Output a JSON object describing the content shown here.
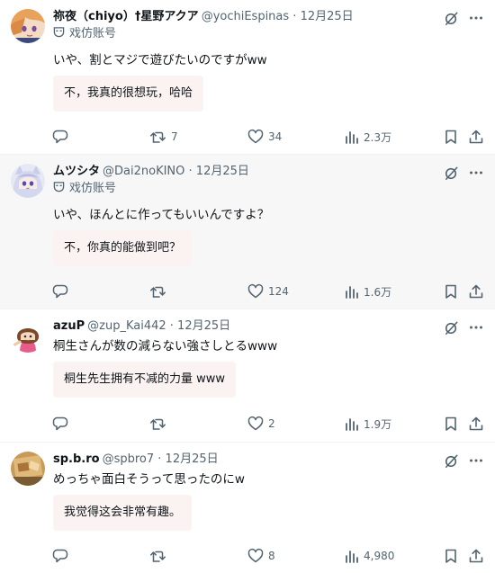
{
  "posts": [
    {
      "display_name": "祢夜（chiyo）†星野アクア",
      "handle": "@yochiEspinas",
      "date": "12月25日",
      "parody_label": "戏仿账号",
      "text": "いや、割とマジで遊びたいのですがww",
      "translation": "不，我真的很想玩，哈哈",
      "replies": "",
      "retweets": "7",
      "likes": "34",
      "views": "2.3万"
    },
    {
      "display_name": "ムツシタ",
      "handle": "@Dai2noKINO",
      "date": "12月25日",
      "parody_label": "戏仿账号",
      "text": "いや、ほんとに作ってもいいんですよ？",
      "translation": "不，你真的能做到吧？",
      "replies": "",
      "retweets": "",
      "likes": "124",
      "views": "1.6万"
    },
    {
      "display_name": "azuP",
      "handle": "@zup_Kai442",
      "date": "12月25日",
      "text": "桐生さんが数の減らない強さしとるwww",
      "translation": "桐生先生拥有不减的力量 www",
      "replies": "",
      "retweets": "",
      "likes": "2",
      "views": "1.9万"
    },
    {
      "display_name": "sp.b.ro",
      "handle": "@spbro7",
      "date": "12月25日",
      "text": "めっちゃ面白そうって思ったのにw",
      "translation": "我觉得这会非常有趣。",
      "replies": "",
      "retweets": "",
      "likes": "8",
      "views": "4,980"
    }
  ],
  "separator": " · ",
  "icons": {
    "grok": "grok-icon",
    "more": "more-icon",
    "parody": "parody-mask-icon",
    "reply": "reply-icon",
    "retweet": "retweet-icon",
    "like": "like-icon",
    "views": "views-icon",
    "bookmark": "bookmark-icon",
    "share": "share-icon"
  },
  "colors": {
    "secondary_text": "#536471",
    "translation_bg": "#fbf3f1",
    "hover_bg": "#f7f7f7",
    "divider": "#eff3f4"
  }
}
